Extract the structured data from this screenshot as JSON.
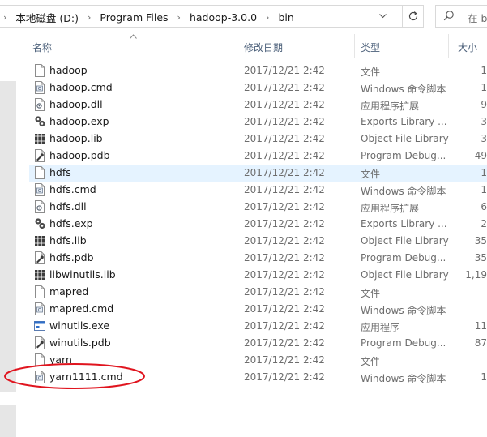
{
  "address": {
    "crumbs": [
      "本地磁盘 (D:)",
      "Program Files",
      "hadoop-3.0.0",
      "bin"
    ],
    "dropdown_icon": "chevron-down-icon",
    "refresh_icon": "refresh-icon"
  },
  "search": {
    "placeholder": "在 b",
    "icon": "search-icon"
  },
  "columns": {
    "name": "名称",
    "date": "修改日期",
    "type": "类型",
    "size": "大小"
  },
  "files": [
    {
      "name": "hadoop",
      "date": "2017/12/21 2:42",
      "type": "文件",
      "size": "1",
      "icon": "file-icon"
    },
    {
      "name": "hadoop.cmd",
      "date": "2017/12/21 2:42",
      "type": "Windows 命令脚本",
      "size": "1",
      "icon": "cmd-script-icon"
    },
    {
      "name": "hadoop.dll",
      "date": "2017/12/21 2:42",
      "type": "应用程序扩展",
      "size": "9",
      "icon": "dll-icon"
    },
    {
      "name": "hadoop.exp",
      "date": "2017/12/21 2:42",
      "type": "Exports Library ...",
      "size": "3",
      "icon": "exp-icon"
    },
    {
      "name": "hadoop.lib",
      "date": "2017/12/21 2:42",
      "type": "Object File Library",
      "size": "3",
      "icon": "lib-icon"
    },
    {
      "name": "hadoop.pdb",
      "date": "2017/12/21 2:42",
      "type": "Program Debug...",
      "size": "49",
      "icon": "pdb-icon"
    },
    {
      "name": "hdfs",
      "date": "2017/12/21 2:42",
      "type": "文件",
      "size": "1",
      "icon": "file-icon",
      "selected": true
    },
    {
      "name": "hdfs.cmd",
      "date": "2017/12/21 2:42",
      "type": "Windows 命令脚本",
      "size": "1",
      "icon": "cmd-script-icon"
    },
    {
      "name": "hdfs.dll",
      "date": "2017/12/21 2:42",
      "type": "应用程序扩展",
      "size": "6",
      "icon": "dll-icon"
    },
    {
      "name": "hdfs.exp",
      "date": "2017/12/21 2:42",
      "type": "Exports Library ...",
      "size": "2",
      "icon": "exp-icon"
    },
    {
      "name": "hdfs.lib",
      "date": "2017/12/21 2:42",
      "type": "Object File Library",
      "size": "35",
      "icon": "lib-icon"
    },
    {
      "name": "hdfs.pdb",
      "date": "2017/12/21 2:42",
      "type": "Program Debug...",
      "size": "35",
      "icon": "pdb-icon"
    },
    {
      "name": "libwinutils.lib",
      "date": "2017/12/21 2:42",
      "type": "Object File Library",
      "size": "1,19",
      "icon": "lib-icon"
    },
    {
      "name": "mapred",
      "date": "2017/12/21 2:42",
      "type": "文件",
      "size": "",
      "icon": "file-icon"
    },
    {
      "name": "mapred.cmd",
      "date": "2017/12/21 2:42",
      "type": "Windows 命令脚本",
      "size": "",
      "icon": "cmd-script-icon"
    },
    {
      "name": "winutils.exe",
      "date": "2017/12/21 2:42",
      "type": "应用程序",
      "size": "11",
      "icon": "exe-icon"
    },
    {
      "name": "winutils.pdb",
      "date": "2017/12/21 2:42",
      "type": "Program Debug...",
      "size": "87",
      "icon": "pdb-icon"
    },
    {
      "name": "yarn",
      "date": "2017/12/21 2:42",
      "type": "文件",
      "size": "",
      "icon": "file-icon"
    },
    {
      "name": "yarn1111.cmd",
      "date": "2017/12/21 2:42",
      "type": "Windows 命令脚本",
      "size": "1",
      "icon": "cmd-script-icon",
      "annotated": true
    }
  ],
  "colors": {
    "selection": "#e5f3ff",
    "header_text": "#4c607a",
    "annotation_circle": "#e0141e"
  }
}
